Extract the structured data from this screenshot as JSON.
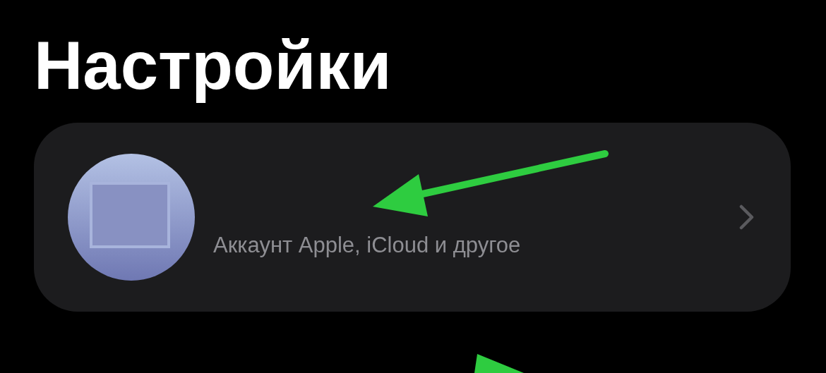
{
  "title": "Настройки",
  "account_card": {
    "subtitle": "Аккаунт Apple, iCloud и другое"
  }
}
